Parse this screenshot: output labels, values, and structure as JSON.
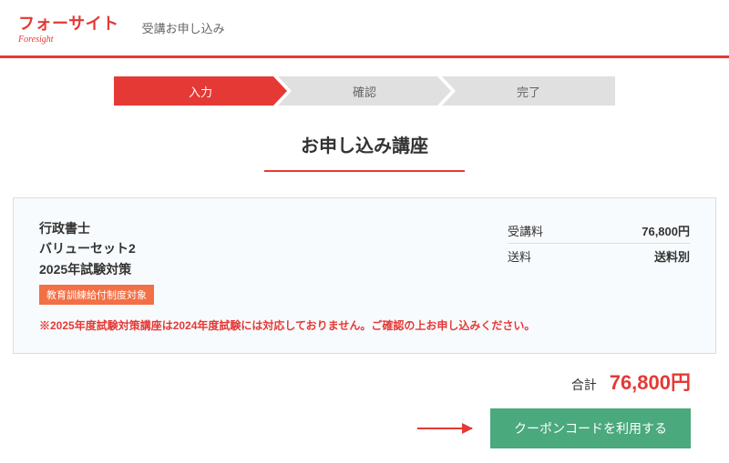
{
  "header": {
    "logo_main": "フォーサイト",
    "logo_sub": "Foresight",
    "page_label": "受講お申し込み"
  },
  "steps": {
    "input": "入力",
    "confirm": "確認",
    "complete": "完了"
  },
  "section_title": "お申し込み講座",
  "course": {
    "line1": "行政書士",
    "line2": "バリューセット2",
    "line3": "2025年試験対策",
    "badge": "教育訓練給付制度対象",
    "price_rows": {
      "tuition_label": "受講料",
      "tuition_value": "76,800円",
      "shipping_label": "送料",
      "shipping_value": "送料別"
    },
    "notice": "※2025年度試験対策講座は2024年度試験には対応しておりません。ご確認の上お申し込みください。"
  },
  "totals": {
    "label": "合計",
    "value": "76,800円"
  },
  "actions": {
    "coupon_button": "クーポンコードを利用する"
  }
}
